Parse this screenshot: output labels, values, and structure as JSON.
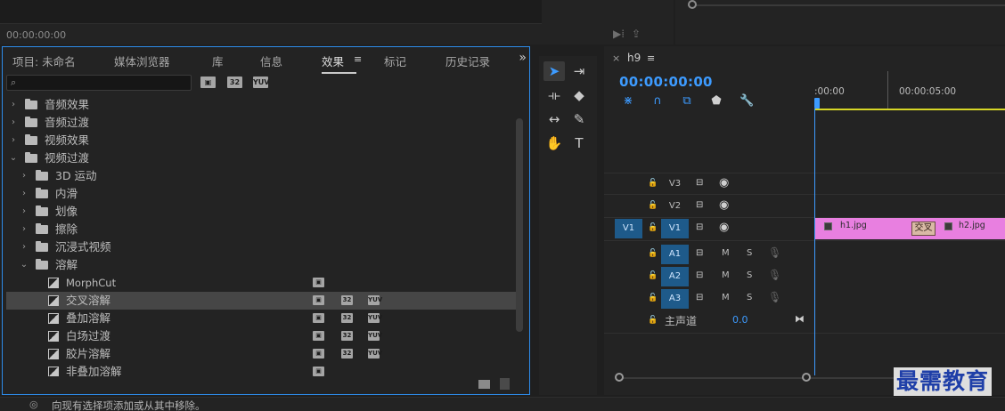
{
  "top": {
    "timecode": "00:00:00:00"
  },
  "effects_panel": {
    "tabs": [
      {
        "label": "项目: 未命名"
      },
      {
        "label": "媒体浏览器"
      },
      {
        "label": "库"
      },
      {
        "label": "信息"
      },
      {
        "label": "效果"
      },
      {
        "label": "标记"
      },
      {
        "label": "历史记录"
      }
    ],
    "active_tab": "效果",
    "overflow": "»",
    "search": {
      "value": "",
      "placeholder": ""
    },
    "filter_badges": [
      "32",
      "YUV"
    ],
    "tree": [
      {
        "label": "音频效果",
        "level": 0,
        "type": "folder",
        "expanded": false
      },
      {
        "label": "音频过渡",
        "level": 0,
        "type": "folder",
        "expanded": false
      },
      {
        "label": "视频效果",
        "level": 0,
        "type": "folder",
        "expanded": false
      },
      {
        "label": "视频过渡",
        "level": 0,
        "type": "folder",
        "expanded": true
      },
      {
        "label": "3D 运动",
        "level": 1,
        "type": "folder",
        "expanded": false
      },
      {
        "label": "内滑",
        "level": 1,
        "type": "folder",
        "expanded": false
      },
      {
        "label": "划像",
        "level": 1,
        "type": "folder",
        "expanded": false
      },
      {
        "label": "擦除",
        "level": 1,
        "type": "folder",
        "expanded": false
      },
      {
        "label": "沉浸式视频",
        "level": 1,
        "type": "folder",
        "expanded": false
      },
      {
        "label": "溶解",
        "level": 1,
        "type": "folder",
        "expanded": true
      },
      {
        "label": "MorphCut",
        "level": 2,
        "type": "effect",
        "badges": [
          "accel"
        ]
      },
      {
        "label": "交叉溶解",
        "level": 2,
        "type": "effect",
        "badges": [
          "accel",
          "32",
          "YUV"
        ],
        "selected": true
      },
      {
        "label": "叠加溶解",
        "level": 2,
        "type": "effect",
        "badges": [
          "accel",
          "32",
          "YUV"
        ]
      },
      {
        "label": "白场过渡",
        "level": 2,
        "type": "effect",
        "badges": [
          "accel",
          "32",
          "YUV"
        ]
      },
      {
        "label": "胶片溶解",
        "level": 2,
        "type": "effect",
        "badges": [
          "accel",
          "32",
          "YUV"
        ]
      },
      {
        "label": "非叠加溶解",
        "level": 2,
        "type": "effect",
        "badges": [
          "accel"
        ]
      }
    ]
  },
  "tools": [
    {
      "name": "selection-tool-icon",
      "glyph": "➤",
      "active": true
    },
    {
      "name": "track-select-tool-icon",
      "glyph": "⇥"
    },
    {
      "name": "ripple-edit-tool-icon",
      "glyph": "⟛"
    },
    {
      "name": "razor-tool-icon",
      "glyph": "◆"
    },
    {
      "name": "slip-tool-icon",
      "glyph": "↔"
    },
    {
      "name": "pen-tool-icon",
      "glyph": "✎"
    },
    {
      "name": "hand-tool-icon",
      "glyph": "✋"
    },
    {
      "name": "type-tool-icon",
      "glyph": "T"
    }
  ],
  "timeline": {
    "sequence_name": "h9",
    "timecode": "00:00:00:00",
    "ruler_labels": [
      ":00:00",
      "00:00:05:00"
    ],
    "video_tracks": [
      {
        "name": "V3",
        "target": false
      },
      {
        "name": "V2",
        "target": false
      },
      {
        "name": "V1",
        "target": true,
        "source": "V1"
      }
    ],
    "audio_tracks": [
      {
        "name": "A1",
        "m": "M",
        "s": "S"
      },
      {
        "name": "A2",
        "m": "M",
        "s": "S"
      },
      {
        "name": "A3",
        "m": "M",
        "s": "S"
      }
    ],
    "master": {
      "label": "主声道",
      "value": "0.0"
    },
    "clips": [
      {
        "name": "h1.jpg"
      },
      {
        "name": "h2.jpg"
      }
    ],
    "transition_label": "交叉",
    "clip_color": "#e87fe0"
  },
  "status": {
    "message": "向现有选择项添加或从其中移除。"
  },
  "watermark": "最需教育",
  "accent_color": "#3d9bff"
}
